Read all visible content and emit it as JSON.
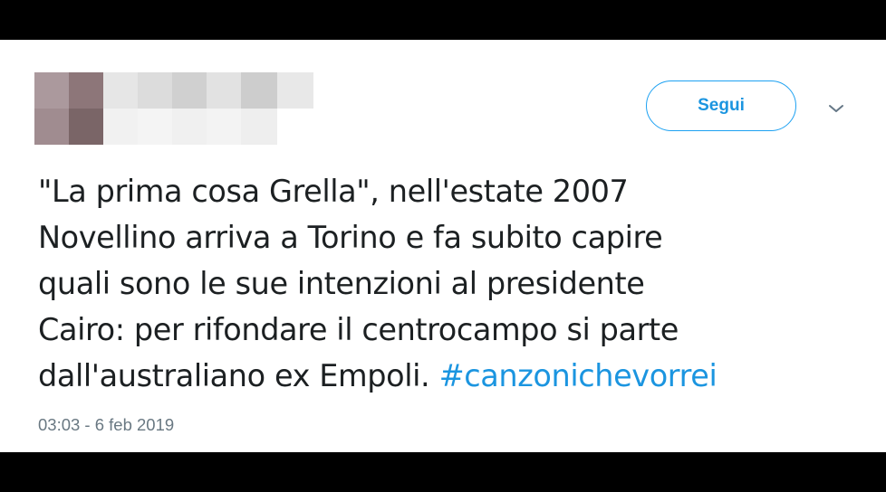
{
  "tweet": {
    "follow_label": "Segui",
    "text_lines": [
      "\"La prima cosa Grella\", nell'estate 2007",
      "Novellino arriva a Torino e fa subito capire",
      "quali sono le sue intenzioni al presidente",
      "Cairo: per rifondare il centrocampo si parte",
      "dall'australiano ex Empoli. "
    ],
    "hashtag": "#canzonichevorrei",
    "timestamp": "03:03 - 6 feb 2019"
  },
  "icons": {
    "menu": "chevron-down-icon",
    "avatar": "pixelated-avatar"
  },
  "colors": {
    "accent": "#1b95e0",
    "border": "#1da1f2",
    "text": "#1c2022",
    "muted": "#697882",
    "frame": "#000000"
  }
}
